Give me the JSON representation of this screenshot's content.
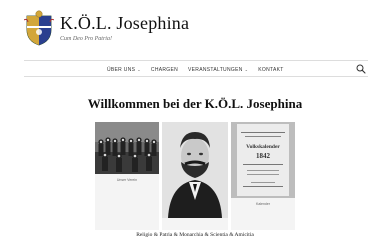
{
  "site": {
    "title": "K.Ö.L. Josephina",
    "tagline": "Cum Deo Pro Patria!"
  },
  "nav": {
    "items": [
      {
        "label": "ÜBER UNS",
        "has_dropdown": true
      },
      {
        "label": "CHARGEN",
        "has_dropdown": false
      },
      {
        "label": "VERANSTALTUNGEN",
        "has_dropdown": true
      },
      {
        "label": "KONTAKT",
        "has_dropdown": false
      }
    ],
    "search_icon": "search-icon"
  },
  "main": {
    "heading": "Willkommen bei der K.Ö.L. Josephina",
    "gallery": [
      {
        "caption": "Unser Verein"
      },
      {
        "caption": ""
      },
      {
        "caption": "Kalender"
      }
    ],
    "calendar_title": "Volkskalender",
    "calendar_year": "1842",
    "motto": "Religio & Patria & Monarchia & Scientia & Amicitia"
  },
  "colors": {
    "accent": "#2a3f8f",
    "gold": "#d2a63a",
    "green": "#2f6b3a"
  }
}
